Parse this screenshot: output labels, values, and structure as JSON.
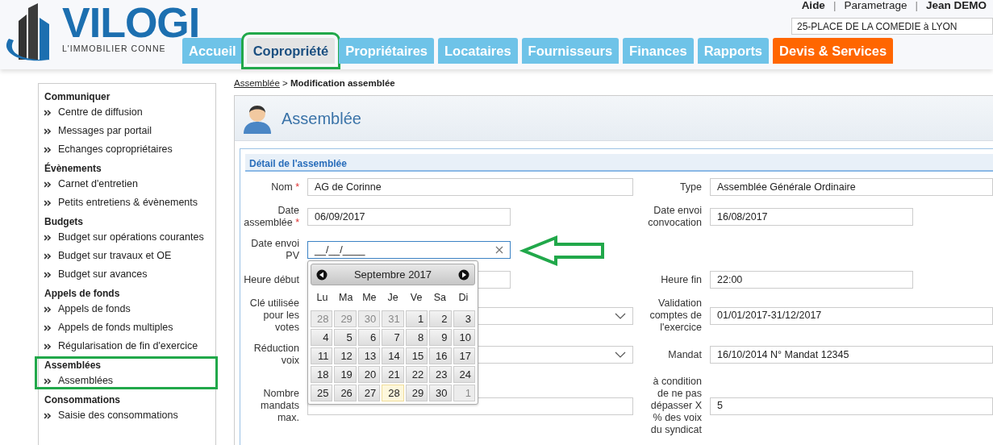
{
  "header": {
    "logo": {
      "name": "VILOGI",
      "tagline": "L'IMMOBILIER CONNE"
    },
    "top_links": [
      {
        "kind": "link",
        "label": "Aide",
        "bold": true
      },
      {
        "kind": "separator",
        "label": "|",
        "bold": false
      },
      {
        "kind": "link",
        "label": "Parametrage",
        "bold": false
      },
      {
        "kind": "separator",
        "label": "|",
        "bold": false
      },
      {
        "kind": "link",
        "label": "Jean DEMO",
        "bold": true
      }
    ],
    "building_select": {
      "value": "25-PLACE DE LA COMEDIE à LYON"
    }
  },
  "nav_tabs": [
    {
      "label": "Accueil",
      "selected": false,
      "kind": "standard",
      "highlighted": false
    },
    {
      "label": "Copropriété",
      "selected": true,
      "kind": "standard",
      "highlighted": true
    },
    {
      "label": "Propriétaires",
      "selected": false,
      "kind": "standard",
      "highlighted": false
    },
    {
      "label": "Locataires",
      "selected": false,
      "kind": "standard",
      "highlighted": false
    },
    {
      "label": "Fournisseurs",
      "selected": false,
      "kind": "standard",
      "highlighted": false
    },
    {
      "label": "Finances",
      "selected": false,
      "kind": "standard",
      "highlighted": false
    },
    {
      "label": "Rapports",
      "selected": false,
      "kind": "standard",
      "highlighted": false
    },
    {
      "label": "Devis & Services",
      "selected": false,
      "kind": "promo",
      "highlighted": false
    }
  ],
  "sidebar": {
    "groups": [
      {
        "title": "Communiquer",
        "highlighted": false,
        "items": [
          "Centre de diffusion",
          "Messages par portail",
          "Echanges copropriétaires"
        ]
      },
      {
        "title": "Évènements",
        "highlighted": false,
        "items": [
          "Carnet d'entretien",
          "Petits entretiens & évènements"
        ]
      },
      {
        "title": "Budgets",
        "highlighted": false,
        "items": [
          "Budget sur opérations courantes",
          "Budget sur travaux et OE",
          "Budget sur avances"
        ]
      },
      {
        "title": "Appels de fonds",
        "highlighted": false,
        "items": [
          "Appels de fonds",
          "Appels de fonds multiples",
          "Régularisation de fin d'exercice"
        ]
      },
      {
        "title": "Assemblées",
        "highlighted": true,
        "items": [
          "Assemblées"
        ]
      },
      {
        "title": "Consommations",
        "highlighted": false,
        "items": [
          "Saisie des consommations"
        ]
      }
    ]
  },
  "breadcrumb": {
    "link": "Assemblée",
    "separator": ">",
    "current": "Modification assemblée"
  },
  "panel": {
    "title": "Assemblée",
    "section_title": "Détail de l'assemblée",
    "rows": [
      {
        "left": {
          "label": "Nom",
          "required_mark": "*",
          "kind": "text",
          "value": "AG de Corinne"
        },
        "right": {
          "label": "Type",
          "kind": "text",
          "value": "Assemblée Générale Ordinaire"
        }
      },
      {
        "left": {
          "label": "Date assemblée",
          "required_mark": "*",
          "kind": "short_text",
          "value": "06/09/2017"
        },
        "right": {
          "label": "Date envoi convocation",
          "kind": "short_text",
          "value": "16/08/2017"
        }
      },
      {
        "left": {
          "label": "Date envoi PV",
          "kind": "date",
          "value": "__/__/____",
          "focused": true,
          "pointed": true
        }
      },
      {
        "left": {
          "label": "Heure début",
          "kind": "short_text"
        },
        "right": {
          "label": "Heure fin",
          "kind": "short_text",
          "value": "22:00"
        }
      },
      {
        "left": {
          "label": "Clé utilisée pour les votes",
          "kind": "select"
        },
        "right": {
          "label": "Validation comptes de l'exercice",
          "kind": "text",
          "value": "01/01/2017-31/12/2017"
        }
      },
      {
        "left": {
          "label": "Réduction voix",
          "kind": "select"
        },
        "right": {
          "label": "Mandat",
          "kind": "text",
          "value": "16/10/2014 N° Mandat 12345"
        }
      },
      {
        "left": {
          "label": "Nombre mandats max.",
          "kind": "text"
        },
        "right": {
          "label": "à condition de ne pas dépasser X % des voix du syndicat",
          "kind": "text",
          "value": "5"
        }
      }
    ]
  },
  "datepicker": {
    "month_label": "Septembre 2017",
    "weekdays": [
      "Lu",
      "Ma",
      "Me",
      "Je",
      "Ve",
      "Sa",
      "Di"
    ],
    "days": [
      {
        "label": "28",
        "other_month": true,
        "today": false
      },
      {
        "label": "29",
        "other_month": true,
        "today": false
      },
      {
        "label": "30",
        "other_month": true,
        "today": false
      },
      {
        "label": "31",
        "other_month": true,
        "today": false
      },
      {
        "label": "1",
        "other_month": false,
        "today": false
      },
      {
        "label": "2",
        "other_month": false,
        "today": false
      },
      {
        "label": "3",
        "other_month": false,
        "today": false
      },
      {
        "label": "4",
        "other_month": false,
        "today": false
      },
      {
        "label": "5",
        "other_month": false,
        "today": false
      },
      {
        "label": "6",
        "other_month": false,
        "today": false
      },
      {
        "label": "7",
        "other_month": false,
        "today": false
      },
      {
        "label": "8",
        "other_month": false,
        "today": false
      },
      {
        "label": "9",
        "other_month": false,
        "today": false
      },
      {
        "label": "10",
        "other_month": false,
        "today": false
      },
      {
        "label": "11",
        "other_month": false,
        "today": false
      },
      {
        "label": "12",
        "other_month": false,
        "today": false
      },
      {
        "label": "13",
        "other_month": false,
        "today": false
      },
      {
        "label": "14",
        "other_month": false,
        "today": false
      },
      {
        "label": "15",
        "other_month": false,
        "today": false
      },
      {
        "label": "16",
        "other_month": false,
        "today": false
      },
      {
        "label": "17",
        "other_month": false,
        "today": false
      },
      {
        "label": "18",
        "other_month": false,
        "today": false
      },
      {
        "label": "19",
        "other_month": false,
        "today": false
      },
      {
        "label": "20",
        "other_month": false,
        "today": false
      },
      {
        "label": "21",
        "other_month": false,
        "today": false
      },
      {
        "label": "22",
        "other_month": false,
        "today": false
      },
      {
        "label": "23",
        "other_month": false,
        "today": false
      },
      {
        "label": "24",
        "other_month": false,
        "today": false
      },
      {
        "label": "25",
        "other_month": false,
        "today": false
      },
      {
        "label": "26",
        "other_month": false,
        "today": false
      },
      {
        "label": "27",
        "other_month": false,
        "today": false
      },
      {
        "label": "28",
        "other_month": false,
        "today": true
      },
      {
        "label": "29",
        "other_month": false,
        "today": false
      },
      {
        "label": "30",
        "other_month": false,
        "today": false
      },
      {
        "label": "1",
        "other_month": true,
        "today": false
      }
    ]
  }
}
